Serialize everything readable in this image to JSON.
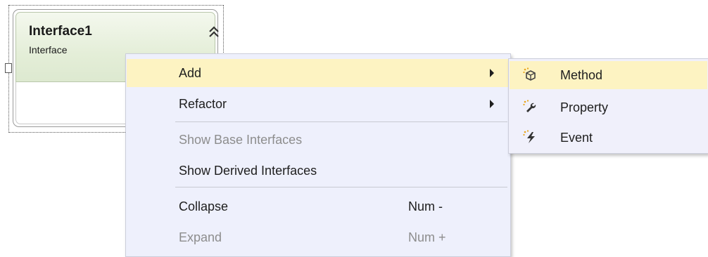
{
  "shape": {
    "title": "Interface1",
    "subtitle": "Interface",
    "collapse_icon": "double-chevron-up-icon"
  },
  "context_menu": {
    "items": [
      {
        "label": "Add",
        "submenu": true,
        "highlighted": true,
        "enabled": true
      },
      {
        "label": "Refactor",
        "submenu": true,
        "enabled": true
      },
      {
        "label": "Show Base Interfaces",
        "enabled": false
      },
      {
        "label": "Show Derived Interfaces",
        "enabled": true
      },
      {
        "label": "Collapse",
        "shortcut": "Num -",
        "enabled": true
      },
      {
        "label": "Expand",
        "shortcut": "Num +",
        "enabled": false
      }
    ]
  },
  "add_submenu": {
    "items": [
      {
        "label": "Method",
        "icon": "method-cube-icon",
        "highlighted": true
      },
      {
        "label": "Property",
        "icon": "property-wrench-icon"
      },
      {
        "label": "Event",
        "icon": "event-lightning-icon"
      }
    ]
  },
  "colors": {
    "menu_background": "#eef0fc",
    "highlight": "#fdf3c2",
    "disabled_text": "#8d8d8d",
    "shape_header": "#e4eed8"
  }
}
